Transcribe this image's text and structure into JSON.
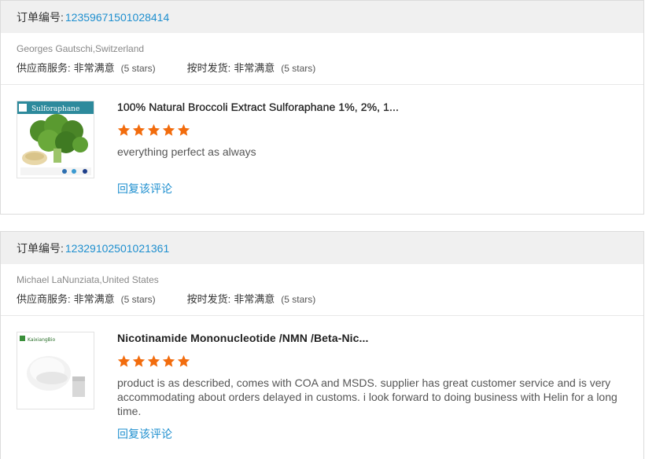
{
  "colors": {
    "accent": "#1e8fcf",
    "star": "#f26c0d",
    "header_bg": "#f0f0f0"
  },
  "reviews": [
    {
      "order_label": "订单编号:",
      "order_no": "12359671501028414",
      "buyer": "Georges Gautschi,Switzerland",
      "supplier_service_label": "供应商服务:",
      "supplier_service_value": "非常满意",
      "supplier_service_stars": "(5 stars)",
      "on_time_label": "按时发货:",
      "on_time_value": "非常满意",
      "on_time_stars": "(5 stars)",
      "product_title": "100% Natural Broccoli Extract Sulforaphane 1%, 2%, 1...",
      "rating": 5,
      "comment": "everything perfect as always",
      "reply_label": "回复该评论",
      "thumb_icon": "broccoli-product-image",
      "thumb_text": "Sulforaphane"
    },
    {
      "order_label": "订单编号:",
      "order_no": "12329102501021361",
      "buyer": "Michael LaNunziata,United States",
      "supplier_service_label": "供应商服务:",
      "supplier_service_value": "非常满意",
      "supplier_service_stars": "(5 stars)",
      "on_time_label": "按时发货:",
      "on_time_value": "非常满意",
      "on_time_stars": "(5 stars)",
      "product_title": "Nicotinamide Mononucleotide /NMN /Beta-Nic...",
      "rating": 5,
      "comment": "product is as described, comes with COA and MSDS. supplier has great customer service and is very accommodating about orders delayed in customs. i look forward to doing business with Helin for a long time.",
      "reply_label": "回复该评论",
      "thumb_icon": "powder-product-image",
      "thumb_text": "KaixiangBio"
    }
  ]
}
